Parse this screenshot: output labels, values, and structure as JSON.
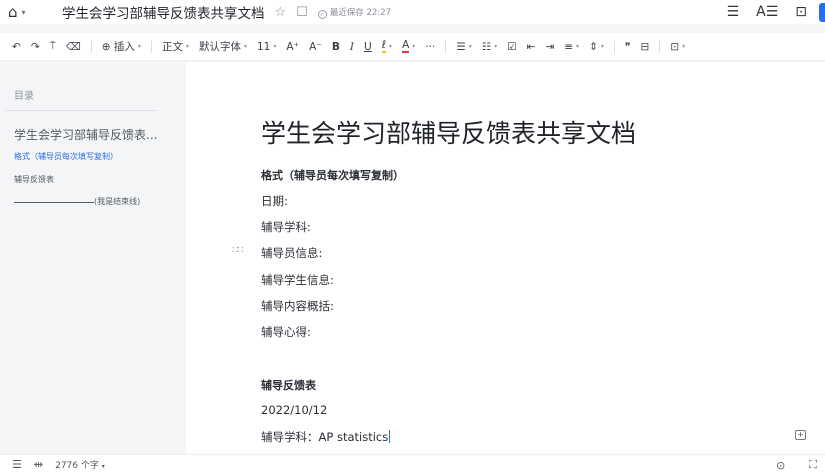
{
  "titlebar": {
    "home_icon": "home-icon",
    "doc_title": "学生会学习部辅导反馈表共享文档",
    "star_icon": "☆",
    "tag_icon": "☐",
    "saved_text": "最近保存 22:27",
    "menu_icon": "☰",
    "font_icon": "A☰",
    "present_icon": "⊡"
  },
  "toolbar": {
    "undo": "↶",
    "redo": "↷",
    "format_painter": "⍑",
    "clear_format": "⌫",
    "insert": "⊕ 插入",
    "style": "正文",
    "font": "默认字体",
    "size": "11",
    "grow": "A⁺",
    "shrink": "A⁻",
    "bold": "B",
    "italic": "I",
    "underline": "U",
    "highlight": "ℓ",
    "font_color": "A",
    "more": "···",
    "bullets": "☰",
    "numbering": "☷",
    "todo": "☑",
    "outdent": "⇤",
    "indent": "⇥",
    "align": "≡",
    "line_spacing": "⇕",
    "quote": "❞",
    "block": "⊟",
    "panel": "⊡"
  },
  "sidebar": {
    "header": "目录",
    "items": [
      {
        "label": "学生会学习部辅导反馈表..."
      },
      {
        "label": "格式（辅导员每次填写复制）"
      },
      {
        "label": "辅导反馈表"
      },
      {
        "label": "(我是结束线)"
      }
    ]
  },
  "doc": {
    "title": "学生会学习部辅导反馈表共享文档",
    "format_heading": "格式（辅导员每次填写复制）",
    "fields": [
      "日期:",
      "辅导学科:",
      "辅导员信息:",
      "辅导学生信息:",
      "辅导内容概括:",
      "辅导心得:"
    ],
    "section_heading": "辅导反馈表",
    "entry_date": "2022/10/12",
    "entry_subject": "辅导学科：AP statistics"
  },
  "statusbar": {
    "outline_icon": "☰",
    "ruler_icon": "⇹",
    "word_count": "2776 个字",
    "play_icon": "⊙",
    "fullscreen_icon": "⛶"
  }
}
